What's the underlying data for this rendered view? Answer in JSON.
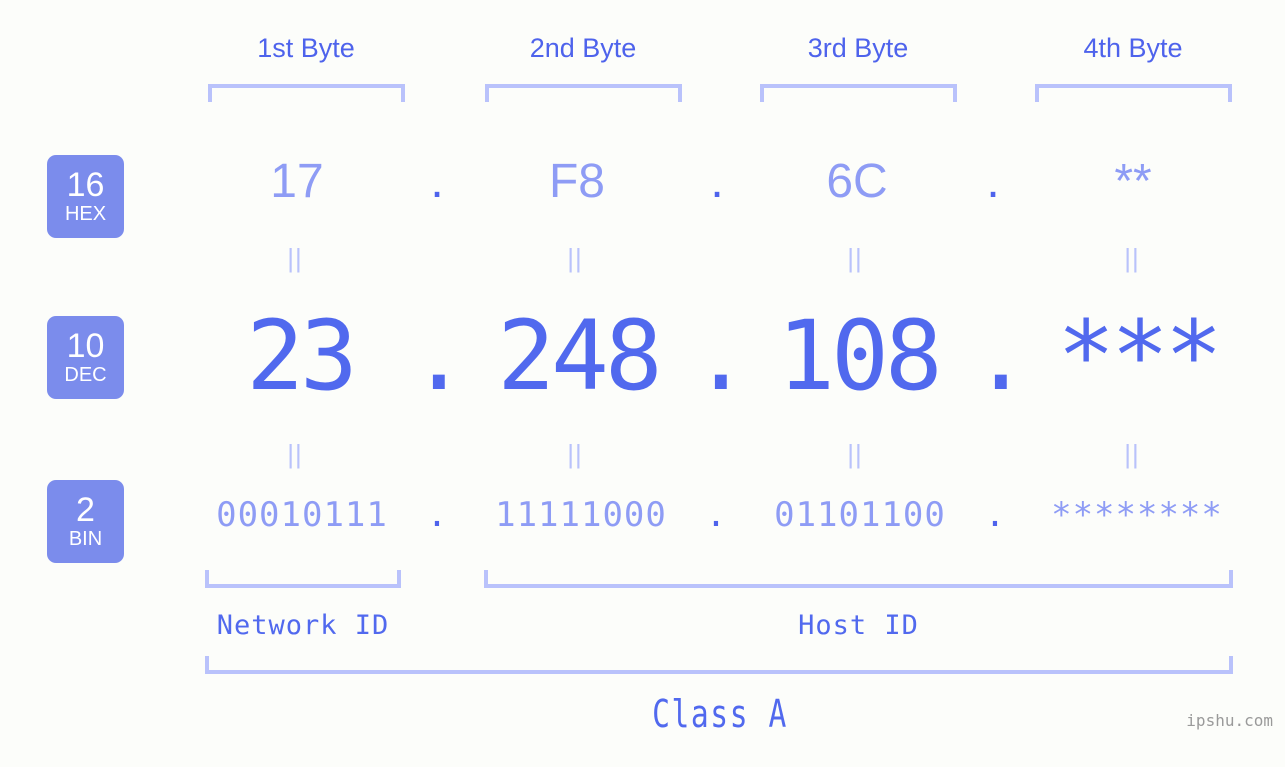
{
  "background_color": "#fcfdfa",
  "accent_color": "#5169ee",
  "accent_light_color": "#8e9cf5",
  "bracket_color": "#b9c2fb",
  "badge_bg_color": "#7b8cec",
  "byte_headers": [
    {
      "label": "1st Byte"
    },
    {
      "label": "2nd Byte"
    },
    {
      "label": "3rd Byte"
    },
    {
      "label": "4th Byte"
    }
  ],
  "rows": [
    {
      "badge_number": "16",
      "badge_name": "HEX",
      "values": [
        "17",
        "F8",
        "6C",
        "**"
      ],
      "separator": "."
    },
    {
      "badge_number": "10",
      "badge_name": "DEC",
      "values": [
        "23",
        "248",
        "108",
        "***"
      ],
      "separator": "."
    },
    {
      "badge_number": "2",
      "badge_name": "BIN",
      "values": [
        "00010111",
        "11111000",
        "01101100",
        "********"
      ],
      "separator": "."
    }
  ],
  "equals_marks": [
    "||",
    "||",
    "||",
    "||"
  ],
  "id_labels": {
    "network": "Network ID",
    "host": "Host ID"
  },
  "class_label": "Class A",
  "watermark": "ipshu.com"
}
